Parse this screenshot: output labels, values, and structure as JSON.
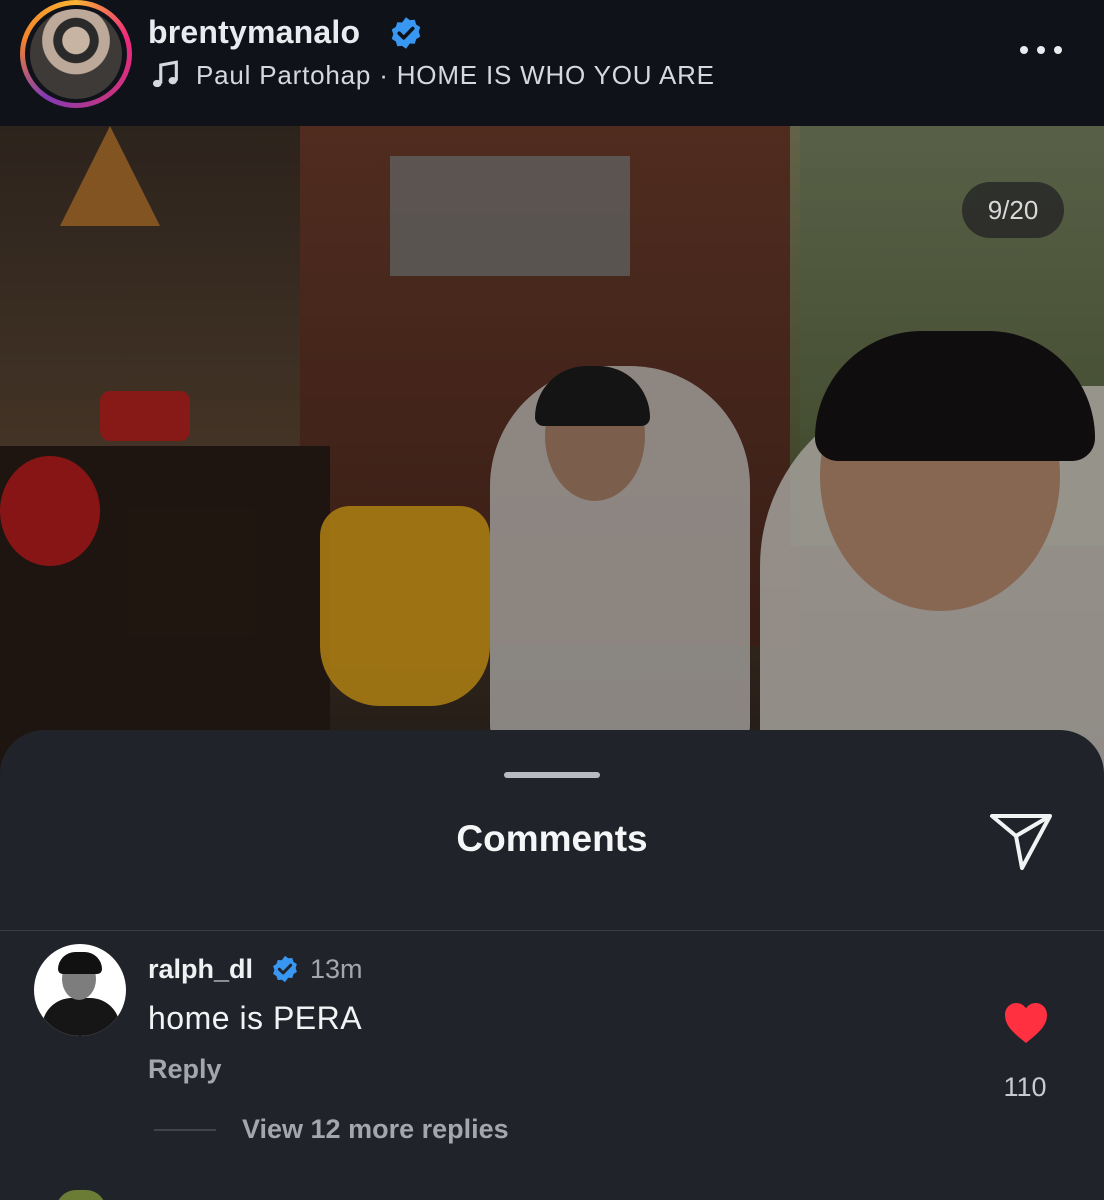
{
  "header": {
    "username": "brentymanalo",
    "song_artist": "Paul Partohap",
    "song_separator": "·",
    "song_title": "HOME IS WHO YOU ARE"
  },
  "media": {
    "counter": "9/20"
  },
  "comments_sheet": {
    "title": "Comments",
    "comments": [
      {
        "username": "ralph_dl",
        "time": "13m",
        "text": "home is PERA",
        "reply_label": "Reply",
        "likes": "110",
        "liked": true,
        "view_replies_label": "View 12 more replies"
      }
    ]
  },
  "colors": {
    "background": "#0e1117",
    "sheet": "#202329",
    "verified": "#3897f0",
    "heart": "#ff3040"
  },
  "icons": [
    "verified-badge-icon",
    "music-note-icon",
    "more-options-icon",
    "send-icon",
    "heart-icon"
  ]
}
